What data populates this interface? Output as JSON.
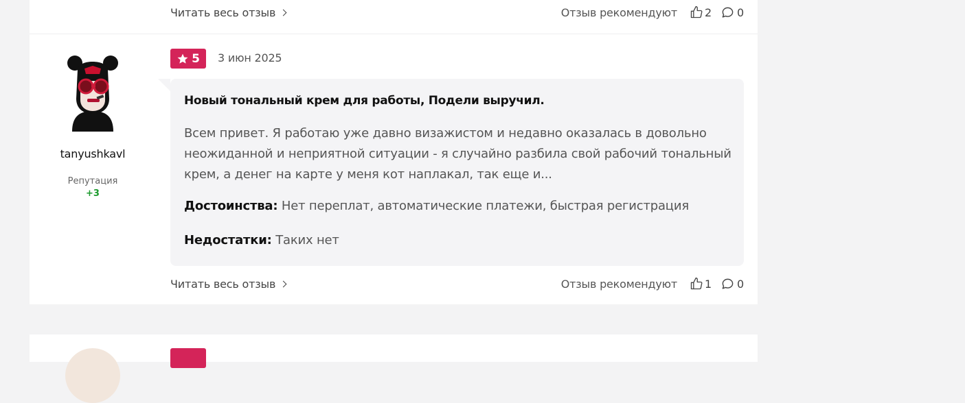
{
  "prev_review": {
    "read_more": "Читать весь отзыв",
    "recommend_label": "Отзыв рекомендуют",
    "likes": "2",
    "comments": "0"
  },
  "review": {
    "username": "tanyushkavl",
    "reputation_label": "Репутация",
    "reputation_value": "+3",
    "rating": "5",
    "date": "3 июн 2025",
    "title": "Новый тональный крем для работы, Подели выручил.",
    "body": "Всем привет. Я работаю уже давно визажистом и недавно оказалась в довольно неожиданной и неприятной ситуации - я случайно разбила свой рабочий тональный крем, а денег на карте у меня кот наплакал, так еще и...",
    "pros_label": "Достоинства:",
    "pros": "Нет переплат, автоматические платежи, быстрая регистрация",
    "cons_label": "Недостатки:",
    "cons": "Таких нет",
    "read_more": "Читать весь отзыв",
    "recommend_label": "Отзыв рекомендуют",
    "likes": "1",
    "comments": "0"
  },
  "colors": {
    "accent": "#d42459",
    "reputation": "#1a9a2c",
    "bubble": "#f4f4f6",
    "page_bg": "#f3f3f4"
  }
}
